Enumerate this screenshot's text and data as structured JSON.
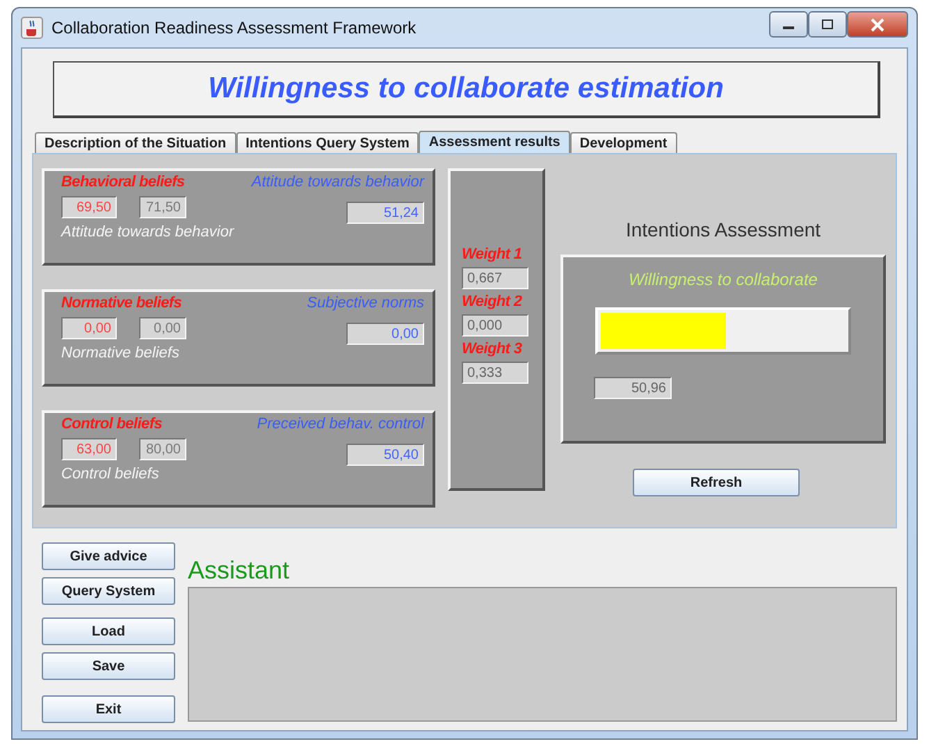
{
  "window": {
    "title": "Collaboration Readiness Assessment Framework"
  },
  "header": {
    "title": "Willingness to collaborate estimation"
  },
  "tabs": [
    {
      "label": "Description of the Situation",
      "selected": false
    },
    {
      "label": "Intentions Query System",
      "selected": false
    },
    {
      "label": "Assessment results",
      "selected": true
    },
    {
      "label": "Development",
      "selected": false
    }
  ],
  "groups": [
    {
      "title": "Behavioral beliefs",
      "result_label": "Attitude towards behavior",
      "beliefs": [
        {
          "value": "69,50",
          "disabled": false
        },
        {
          "value": "71,50",
          "disabled": true
        }
      ],
      "result": "51,24",
      "caption": "Attitude towards behavior"
    },
    {
      "title": "Normative beliefs",
      "result_label": "Subjective norms",
      "beliefs": [
        {
          "value": "0,00",
          "disabled": false
        },
        {
          "value": "0,00",
          "disabled": true
        }
      ],
      "result": "0,00",
      "caption": "Normative beliefs"
    },
    {
      "title": "Control beliefs",
      "result_label": "Preceived behav. control",
      "beliefs": [
        {
          "value": "63,00",
          "disabled": false
        },
        {
          "value": "80,00",
          "disabled": true
        }
      ],
      "result": "50,40",
      "caption": "Control beliefs"
    }
  ],
  "weights": [
    {
      "label": "Weight 1",
      "value": "0,667"
    },
    {
      "label": "Weight 2",
      "value": "0,000"
    },
    {
      "label": "Weight 3",
      "value": "0,333"
    }
  ],
  "intentions": {
    "title": "Intentions Assessment",
    "label": "Willingness to collaborate",
    "level": 0.51,
    "reading": "50,96",
    "button": "Refresh"
  },
  "actions": [
    "Give advice",
    "Query System",
    "Load",
    "Save",
    "Exit"
  ],
  "assistant": {
    "title": "Assistant"
  }
}
